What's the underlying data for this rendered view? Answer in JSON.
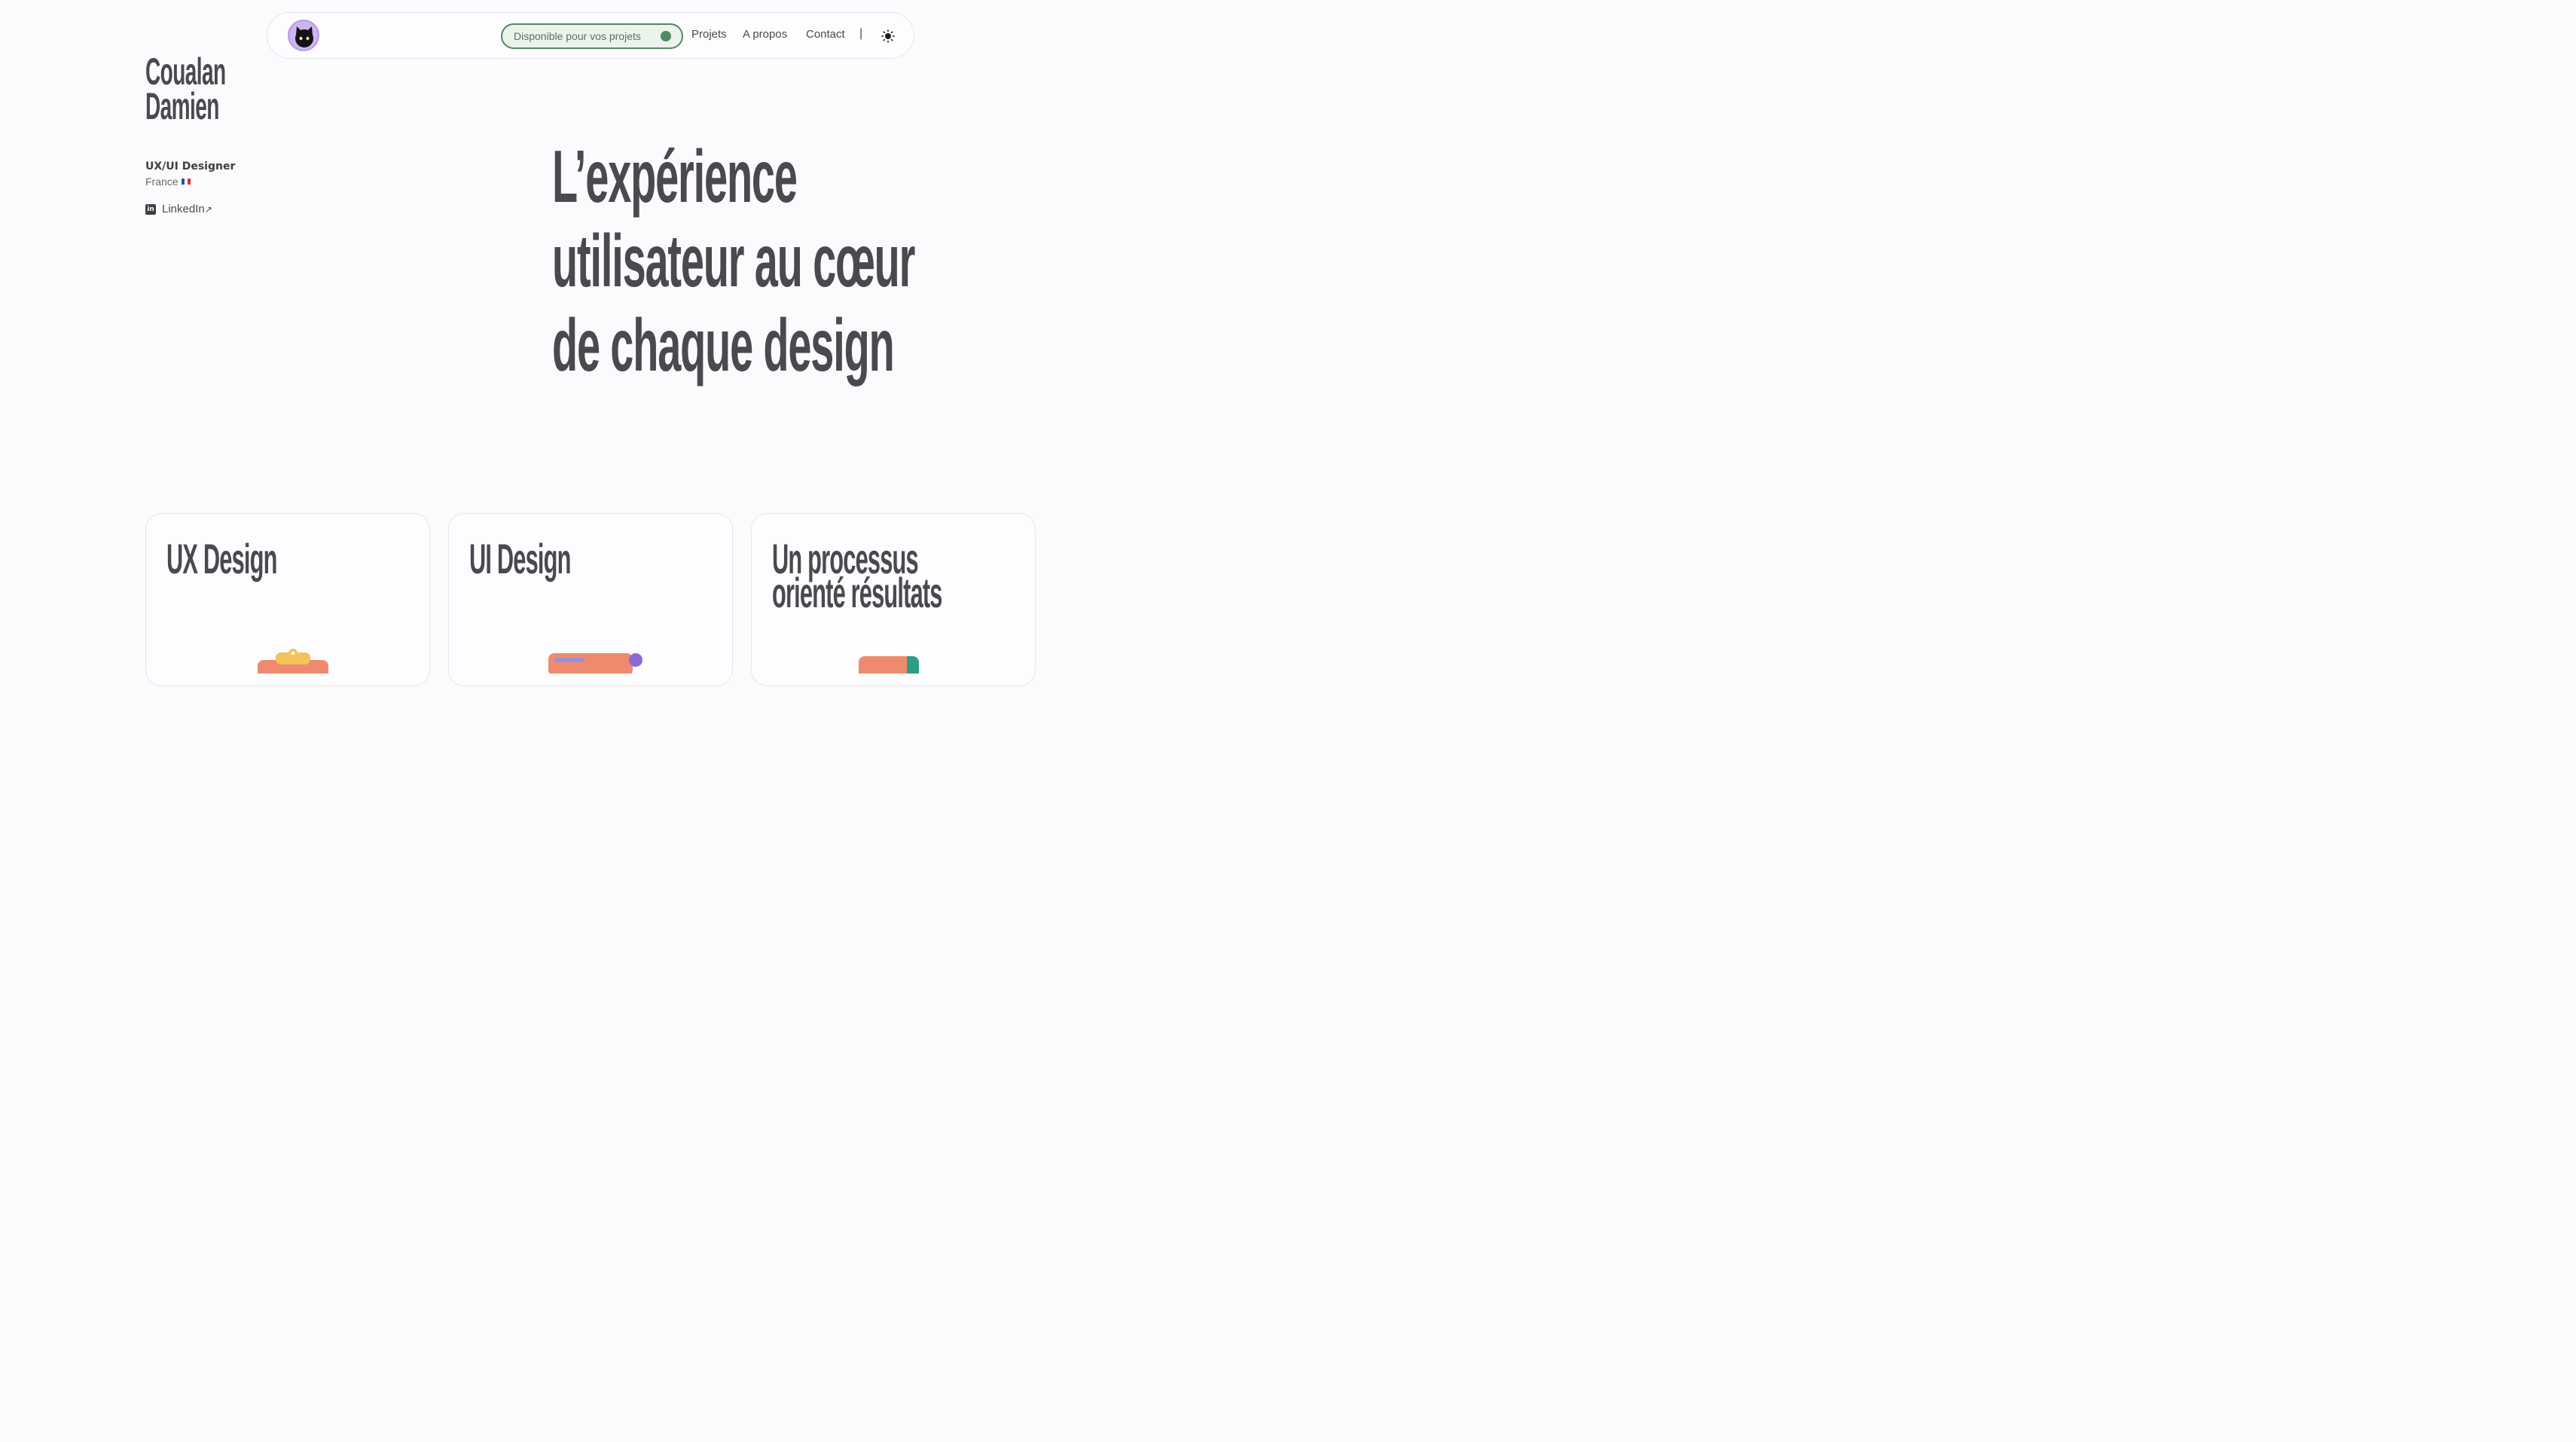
{
  "nav": {
    "availability": "Disponible pour vos projets",
    "links": [
      "Projets",
      "A propos",
      "Contact"
    ],
    "separator": "|",
    "theme_icon": "sun-icon",
    "avatar_icon": "black-cat-avatar"
  },
  "intro": {
    "name_line1": "Coualan",
    "name_line2": "Damien",
    "role": "UX/UI Designer",
    "country": "France",
    "linkedin": "LinkedIn",
    "linkedin_arrow": "↗"
  },
  "hero": {
    "line1": "L’expérience",
    "line2": "utilisateur au cœur",
    "line3": "de chaque design"
  },
  "cards": [
    {
      "title_line1": "UX Design",
      "title_line2": ""
    },
    {
      "title_line1": "UI Design",
      "title_line2": ""
    },
    {
      "title_line1": "Un processus",
      "title_line2": "orienté résultats"
    }
  ],
  "colors": {
    "text": "#4a494d",
    "background": "#fbfafc",
    "accent_green": "#4f8a62",
    "avatar_purple": "#cdb6ee"
  }
}
